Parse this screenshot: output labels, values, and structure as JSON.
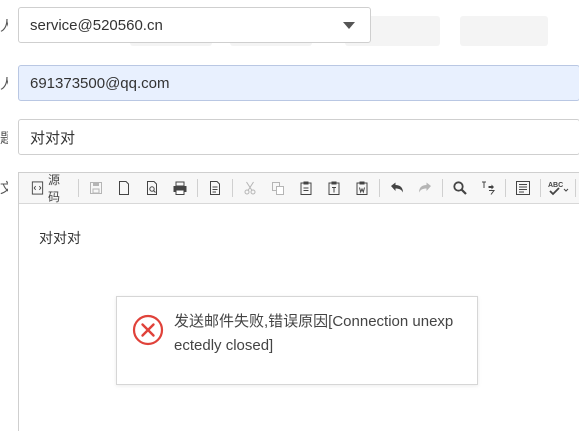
{
  "side_labels": [
    "人",
    "人",
    "题",
    "文"
  ],
  "from": {
    "value": "service@520560.cn"
  },
  "to": {
    "value": "691373500@qq.com"
  },
  "subject": {
    "value": "对对对"
  },
  "toolbar": {
    "source_label": "源码",
    "icons": [
      "save-icon",
      "new-page-icon",
      "preview-icon",
      "print-icon",
      "template-icon",
      "cut-icon",
      "copy-icon",
      "paste-icon",
      "paste-text-icon",
      "paste-word-icon",
      "undo-icon",
      "redo-icon",
      "find-icon",
      "replace-icon",
      "select-all-icon",
      "spellcheck-icon"
    ],
    "spell_label": "ABC"
  },
  "editor": {
    "body": "对对对"
  },
  "dialog": {
    "icon": "error-circle-icon",
    "message": "发送邮件失败,错误原因[Connection unexpectedly closed]",
    "color": "#e0423a"
  }
}
